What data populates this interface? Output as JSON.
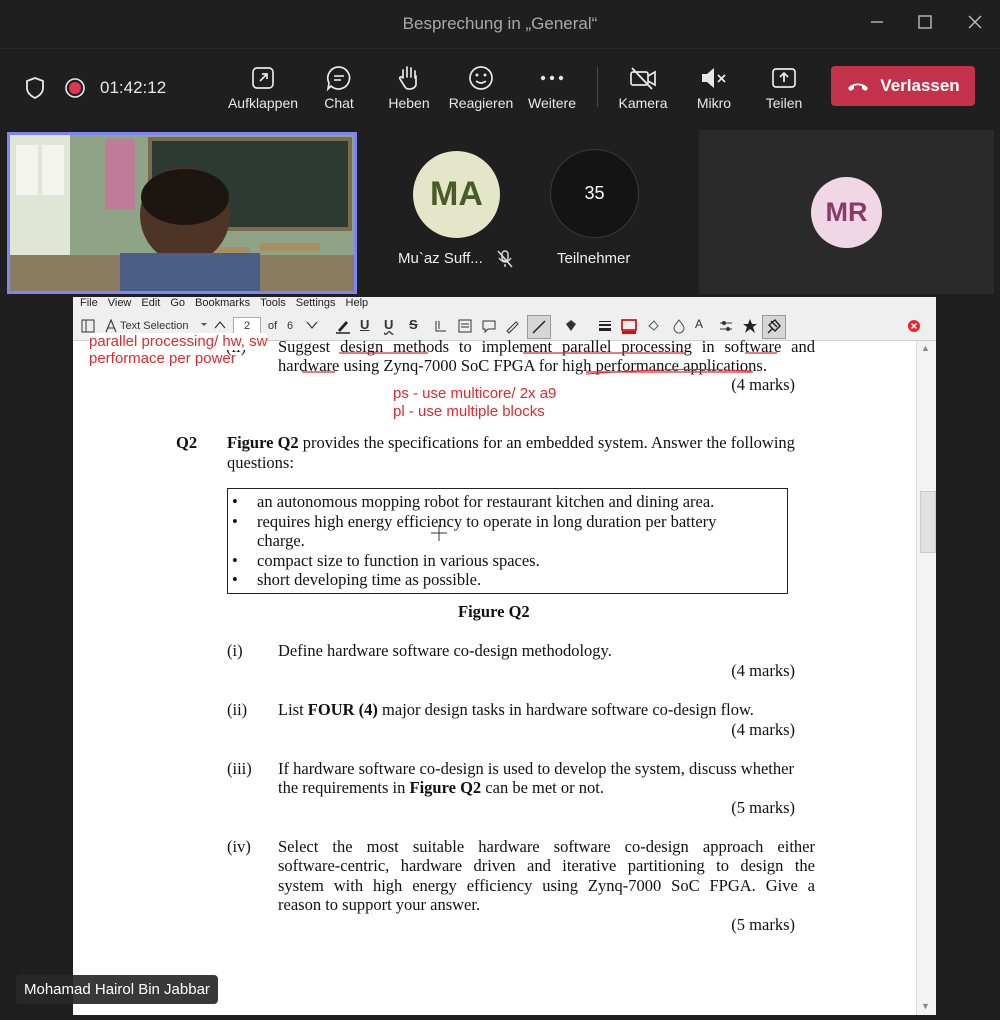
{
  "window": {
    "title": "Besprechung in „General“",
    "minimize_icon": "minimize-icon",
    "maximize_icon": "maximize-icon",
    "close_icon": "close-icon"
  },
  "meeting_toolbar": {
    "timer": "01:42:12",
    "items": [
      {
        "label": "Aufklappen",
        "icon": "pop-out-icon"
      },
      {
        "label": "Chat",
        "icon": "chat-icon"
      },
      {
        "label": "Heben",
        "icon": "raise-hand-icon"
      },
      {
        "label": "Reagieren",
        "icon": "react-icon"
      },
      {
        "label": "Weitere",
        "icon": "more-icon"
      },
      {
        "label": "Kamera",
        "icon": "camera-off-icon"
      },
      {
        "label": "Mikro",
        "icon": "mic-muted-icon"
      },
      {
        "label": "Teilen",
        "icon": "share-icon"
      }
    ],
    "leave_label": "Verlassen",
    "leave_color": "#c4314b"
  },
  "participants": {
    "ma_initials": "MA",
    "ma_name": "Mu`az Suff...",
    "ma_color": "#e3e6c8",
    "count": "35",
    "count_label": "Teilnehmer",
    "mr_initials": "MR",
    "mr_color": "#f0d7e6",
    "presenter_name": "Mohamad Hairol Bin Jabbar"
  },
  "viewer": {
    "menu": [
      "File",
      "View",
      "Edit",
      "Go",
      "Bookmarks",
      "Tools",
      "Settings",
      "Help"
    ],
    "mode_label": "Text Selection",
    "page_current": "2",
    "page_of": "of",
    "page_total": "6"
  },
  "document": {
    "q1_tail_num": "(ii)",
    "q1_line1": "Suggest design methods to implement parallel processing in software and",
    "q1_line2": "hardware using Zynq-7000 SoC FPGA for high performance applications.",
    "q1_marks": "(4 marks)",
    "ann_left_1": "parallel processing/ hw, sw",
    "ann_left_2": "performace per power",
    "ann_ps": "ps - use multicore/ 2x a9",
    "ann_pl": "pl - use multiple blocks",
    "q2_label": "Q2",
    "q2_bold": "Figure Q2",
    "q2_text_1": " provides the specifications for an embedded system. Answer the following",
    "q2_text_2": "questions:",
    "spec_bullets": [
      "an autonomous mopping robot for restaurant kitchen and dining area.",
      "requires high energy efficiency to operate in long duration per battery",
      "charge.",
      "compact size to function in various spaces.",
      "short developing time as possible."
    ],
    "figure_caption": "Figure Q2",
    "parts": [
      {
        "num": "(i)",
        "lines": [
          "Define hardware software co-design methodology."
        ],
        "marks": "(4 marks)"
      },
      {
        "num": "(ii)",
        "pre": "List ",
        "bold": "FOUR (4)",
        "post": " major design tasks in hardware software co-design flow.",
        "marks": "(4 marks)"
      },
      {
        "num": "(iii)",
        "line1": "If hardware software co-design is used to develop the system, discuss whether",
        "pre": "the requirements in ",
        "bold": "Figure Q2",
        "post": " can be met or not.",
        "marks": "(5 marks)"
      },
      {
        "num": "(iv)",
        "lines": [
          "Select the most suitable hardware software co-design approach either",
          "software-centric, hardware driven and iterative partitioning to design the",
          "system with high energy efficiency using Zynq-7000 SoC FPGA. Give a",
          "reason to support your answer."
        ],
        "marks": "(5 marks)"
      }
    ]
  }
}
